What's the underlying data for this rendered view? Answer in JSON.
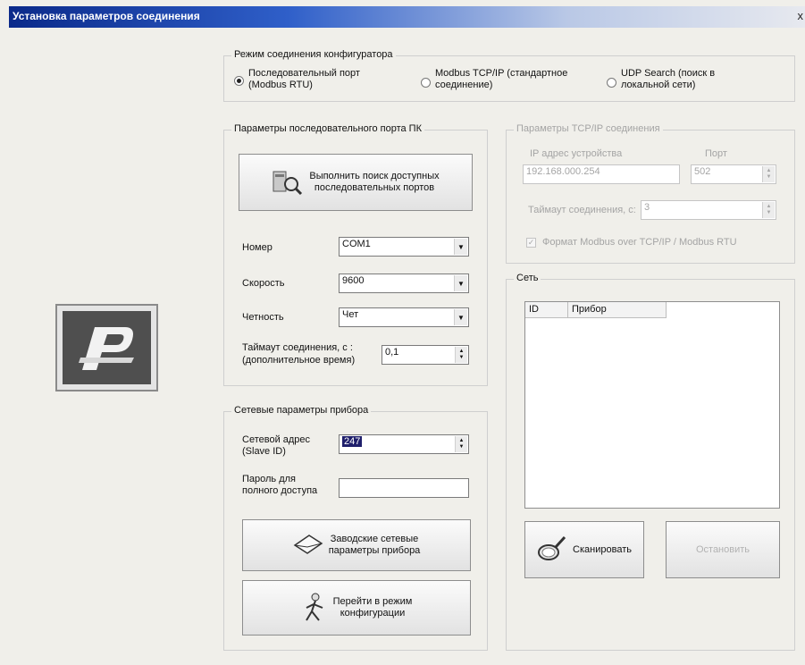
{
  "window": {
    "title": "Установка параметров соединения",
    "close": "x"
  },
  "mode": {
    "title": "Режим соединения конфигуратора",
    "options": [
      {
        "line1": "Последовательный порт",
        "line2": "(Modbus RTU)",
        "selected": true
      },
      {
        "line1": "Modbus TCP/IP (стандартное",
        "line2": "соединение)",
        "selected": false
      },
      {
        "line1": "UDP Search (поиск в",
        "line2": "локальной сети)",
        "selected": false
      }
    ]
  },
  "serial": {
    "title": "Параметры последовательного порта ПК",
    "search_line1": "Выполнить поиск доступных",
    "search_line2": "последовательных портов",
    "port_label": "Номер",
    "port_value": "COM1",
    "speed_label": "Скорость",
    "speed_value": "9600",
    "parity_label": "Четность",
    "parity_value": "Чет",
    "timeout_label1": "Таймаут соединения, с :",
    "timeout_label2": "(дополнительное время)",
    "timeout_value": "0,1"
  },
  "tcp": {
    "title": "Параметры TCP/IP соединения",
    "ip_label": "IP адрес устройства",
    "ip_value": "192.168.000.254",
    "port_label": "Порт",
    "port_value": "502",
    "timeout_label": "Таймаут соединения, с:",
    "timeout_value": "3",
    "format_label": "Формат Modbus over TCP/IP / Modbus RTU",
    "format_checked": true
  },
  "network": {
    "title": "Сеть",
    "col_id": "ID",
    "col_device": "Прибор",
    "scan_label": "Сканировать",
    "stop_label": "Остановить"
  },
  "device": {
    "title": "Сетевые параметры прибора",
    "addr_label1": "Сетевой адрес",
    "addr_label2": "(Slave ID)",
    "addr_value": "247",
    "pwd_label1": "Пароль для",
    "pwd_label2": "полного доступа",
    "pwd_value": "",
    "factory_line1": "Заводские сетевые",
    "factory_line2": "параметры прибора",
    "config_line1": "Перейти в режим",
    "config_line2": "конфигурации"
  },
  "icons": {
    "logo": "p-logo-icon",
    "search": "computer-search-icon",
    "scan": "magnifier-icon",
    "factory": "envelope-icon",
    "config": "figure-icon"
  }
}
